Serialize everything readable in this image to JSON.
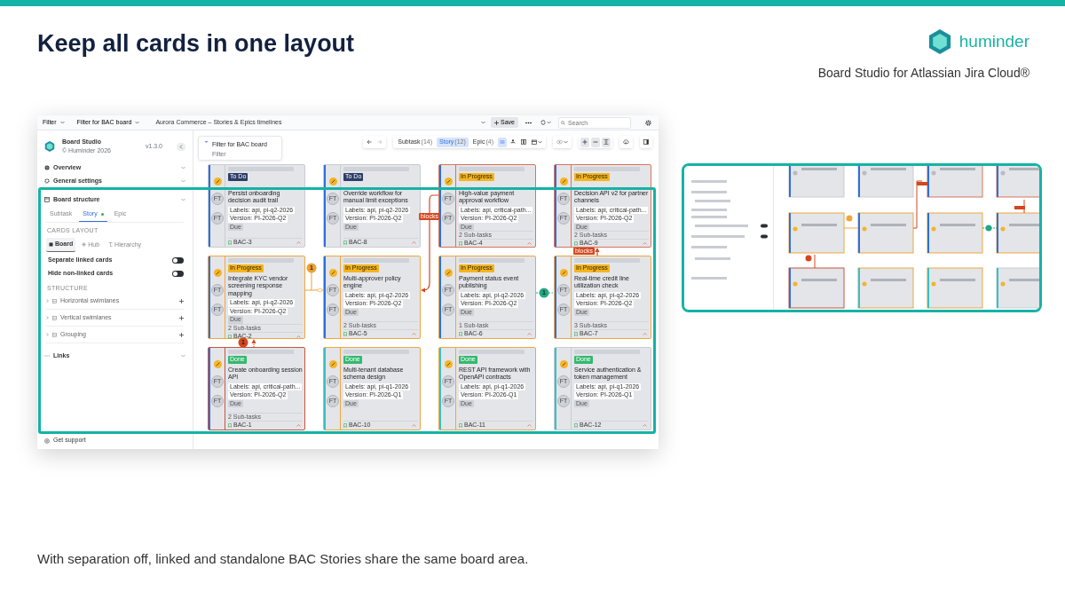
{
  "slide": {
    "title": "Keep all cards in one layout",
    "brand": "huminder",
    "subtitle": "Board Studio for Atlassian Jira Cloud®",
    "caption": "With separation off, linked and standalone BAC Stories share the same board area."
  },
  "topbar": {
    "filters": [
      "Filter",
      "Filter for BAC board"
    ],
    "board_name": "Aurora Commerce – Stories & Epics timelines",
    "save": "Save",
    "search": {
      "placeholder": "Search"
    }
  },
  "sidebar": {
    "app_name": "Board Studio",
    "copyright": "© Huminder 2026",
    "version": "v1.3.0",
    "overview": "Overview",
    "general": "General settings",
    "structure_title": "Board structure",
    "tabs": [
      {
        "label": "Subtask",
        "selected": false,
        "marked": false
      },
      {
        "label": "Story",
        "selected": true,
        "marked": true
      },
      {
        "label": "Epic",
        "selected": false,
        "marked": false
      }
    ],
    "cards_layout_heading": "CARDS LAYOUT",
    "layouts": [
      {
        "label": "Board",
        "selected": true
      },
      {
        "label": "Hub",
        "selected": false
      },
      {
        "label": "Hierarchy",
        "selected": false
      }
    ],
    "toggles": [
      {
        "label": "Separate linked cards",
        "on": false
      },
      {
        "label": "Hide non-linked cards",
        "on": false
      }
    ],
    "structure_heading": "STRUCTURE",
    "structure_items": [
      "Horizontal swimlanes",
      "Vertical swimlanes",
      "Grouping"
    ],
    "links": "Links",
    "support": "Get support"
  },
  "board": {
    "filter": {
      "title": "Filter for BAC board",
      "subtitle": "Filter"
    },
    "type_tabs": [
      {
        "label": "Subtask",
        "count": "(14)",
        "selected": false
      },
      {
        "label": "Story",
        "count": "(12)",
        "selected": true
      },
      {
        "label": "Epic",
        "count": "(4)",
        "selected": false
      }
    ],
    "cards": [
      {
        "key": "BAC-3",
        "status": {
          "label": "To Do",
          "color": "#2c3e66"
        },
        "title": "Persist onboarding decision audit trail",
        "labels": "Labels: api, pi-q2-2026",
        "version": "Version: PI-2026-Q2",
        "due": "Due",
        "color": "#c9ccd3",
        "epic": {
          "color": "#2f6fde"
        },
        "avatars": [
          "FT",
          "FT"
        ]
      },
      {
        "key": "BAC-8",
        "status": {
          "label": "To Do",
          "color": "#2c3e66"
        },
        "title": "Override workflow for manual limit exceptions",
        "labels": "Labels: api, pi-q2-2026",
        "version": "Version: PI-2026-Q2",
        "due": "Due",
        "color": "#c9ccd3",
        "epic": {
          "color": "#2f6fde"
        },
        "avatars": [
          "FT",
          "FT"
        ]
      },
      {
        "key": "BAC-4",
        "status": {
          "label": "In Progress",
          "color": "#f5b51f"
        },
        "title": "High-value payment approval workflow",
        "labels": "Labels: api, critical-path...",
        "version": "Version: PI-2026-Q2",
        "due": "Due",
        "subtasks": "2 Sub-tasks",
        "color": "#d9745a",
        "epic": {
          "color": "#2f6fde"
        },
        "avatars": [
          "FT",
          "FT"
        ]
      },
      {
        "key": "BAC-9",
        "status": {
          "label": "In Progress",
          "color": "#f5b51f"
        },
        "title": "Decision API v2 for partner channels",
        "labels": "Labels: api, critical-path...",
        "version": "Version: PI-2026-Q2",
        "due": "Due",
        "subtasks": "2 Sub-tasks",
        "color": "#d9745a",
        "epic": {
          "color": "#2f6fde"
        },
        "avatars": [
          "FT",
          "FT"
        ]
      },
      {
        "key": "BAC-2",
        "status": {
          "label": "In Progress",
          "color": "#f5b51f"
        },
        "title": "Integrate KYC vendor screening response mapping",
        "labels": "Labels: api, pi-q2-2026",
        "version": "Version: PI-2026-Q2",
        "due": "Due",
        "subtasks": "2 Sub-tasks",
        "color": "#f0a640",
        "epic": {
          "color": "#2f6fde"
        },
        "avatars": [
          "FT",
          "FT"
        ]
      },
      {
        "key": "BAC-5",
        "status": {
          "label": "In Progress",
          "color": "#f5b51f"
        },
        "title": "Multi-approver policy engine",
        "labels": "Labels: api, pi-q2-2026",
        "version": "Version: PI-2026-Q2",
        "due": "Due",
        "subtasks": "2 Sub-tasks",
        "color": "#f0a640",
        "epic": {
          "color": "#2f6fde"
        },
        "avatars": [
          "FT",
          "FT"
        ]
      },
      {
        "key": "BAC-6",
        "status": {
          "label": "In Progress",
          "color": "#f5b51f"
        },
        "title": "Payment status event publishing",
        "labels": "Labels: api, pi-q2-2026",
        "version": "Version: PI-2026-Q2",
        "due": "Due",
        "subtasks": "1 Sub-task",
        "color": "#f0a640",
        "epic": {
          "color": "#2f6fde"
        },
        "avatars": [
          "FT",
          "FT"
        ]
      },
      {
        "key": "BAC-7",
        "status": {
          "label": "In Progress",
          "color": "#f5b51f"
        },
        "title": "Real-time credit line utilization check",
        "labels": "Labels: api, pi-q2-2026",
        "version": "Version: PI-2026-Q2",
        "due": "Due",
        "subtasks": "3 Sub-tasks",
        "color": "#f0a640",
        "epic": {
          "color": "#2f6fde"
        },
        "avatars": [
          "FT",
          "FT"
        ]
      },
      {
        "key": "BAC-1",
        "status": {
          "label": "Done",
          "color": "#35b86e"
        },
        "title": "Create onboarding session API",
        "labels": "Labels: api, critical-path...",
        "version": "Version: PI-2026-Q2",
        "due": "Due",
        "subtasks": "2 Sub-tasks",
        "color": "#c8553d",
        "epic": {
          "color": "#2f6fde"
        },
        "avatars": [
          "FT",
          "FT"
        ]
      },
      {
        "key": "BAC-10",
        "status": {
          "label": "Done",
          "color": "#35b86e"
        },
        "title": "Multi-tenant database schema design",
        "labels": "Labels: api, pi-q1-2026",
        "version": "Version: PI-2026-Q1",
        "due": "Due",
        "color": "#f0a640",
        "epic": {
          "color": "#3bbfc4"
        },
        "avatars": [
          "FT",
          "FT"
        ]
      },
      {
        "key": "BAC-11",
        "status": {
          "label": "Done",
          "color": "#35b86e"
        },
        "title": "REST API framework with OpenAPI contracts",
        "labels": "Labels: api, pi-q1-2026",
        "version": "Version: PI-2026-Q1",
        "due": "Due",
        "color": "#f0a640",
        "epic": {
          "color": "#3bbfc4"
        },
        "avatars": [
          "FT",
          "FT"
        ]
      },
      {
        "key": "BAC-12",
        "status": {
          "label": "Done",
          "color": "#35b86e"
        },
        "title": "Service authentication & token management",
        "labels": "Labels: api, pi-q1-2026",
        "version": "Version: PI-2026-Q1",
        "due": "Due",
        "color": "#c9ccd3",
        "epic": {
          "color": "#3bbfc4"
        },
        "avatars": [
          "FT",
          "FT"
        ]
      }
    ],
    "links": [
      {
        "kind": "arrow",
        "label": "blocks",
        "color": "#d4461e"
      },
      {
        "kind": "arrow",
        "label": "blocks",
        "color": "#d4461e"
      },
      {
        "kind": "diamond",
        "badge": "1",
        "color": "#f0a030"
      },
      {
        "kind": "dashed",
        "badge": "1",
        "color": "#23a884"
      },
      {
        "kind": "dotted",
        "badge": "1",
        "color": "#d4461e"
      }
    ]
  }
}
